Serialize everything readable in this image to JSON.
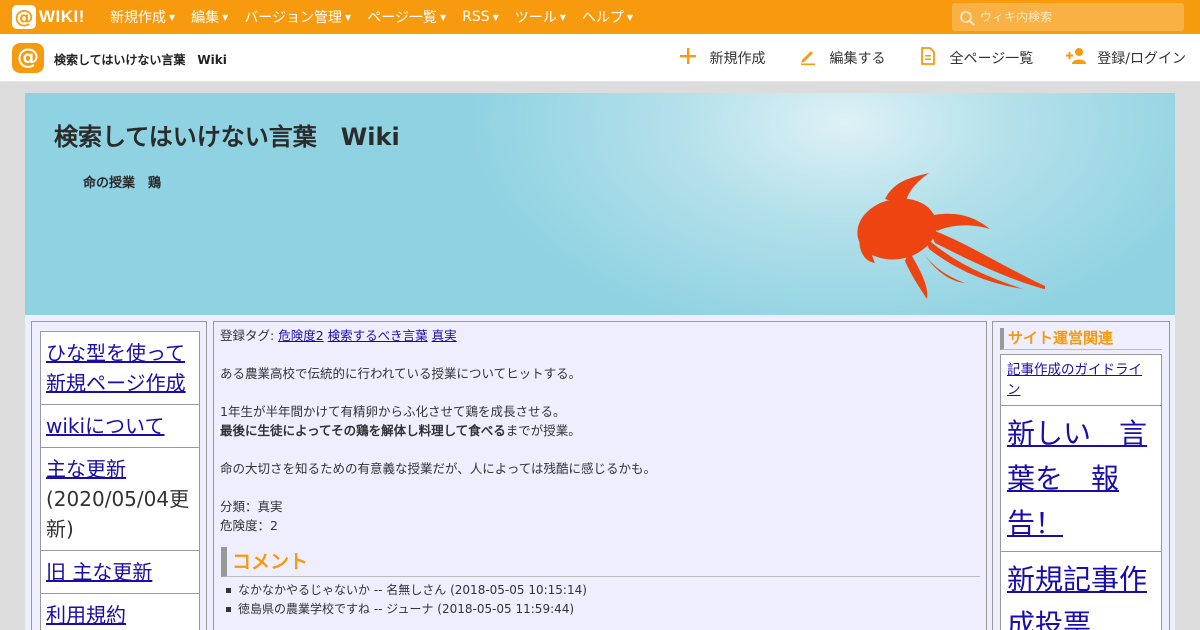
{
  "topbar": {
    "logo_text": "WIKI!",
    "nav": [
      {
        "label": "新規作成"
      },
      {
        "label": "編集"
      },
      {
        "label": "バージョン管理"
      },
      {
        "label": "ページ一覧"
      },
      {
        "label": "RSS"
      },
      {
        "label": "ツール"
      },
      {
        "label": "ヘルプ"
      }
    ],
    "search_placeholder": "ウィキ内検索",
    "accent_color": "#f79a0e"
  },
  "subbar": {
    "site_title": "検索してはいけない言葉　Wiki",
    "actions": [
      {
        "icon": "plus-icon",
        "label": "新規作成"
      },
      {
        "icon": "pencil-icon",
        "label": "編集する"
      },
      {
        "icon": "document-icon",
        "label": "全ページ一覧"
      },
      {
        "icon": "add-user-icon",
        "label": "登録/ログイン"
      }
    ]
  },
  "banner": {
    "title": "検索してはいけない言葉　Wiki",
    "page_name": "命の授業　鶏",
    "image": "goldfish-silhouette"
  },
  "left_menu": {
    "items": [
      {
        "link": "ひな型を使って新規ページ作成",
        "note": ""
      },
      {
        "link": "wikiについて",
        "note": ""
      },
      {
        "link": "主な更新",
        "note": "(2020/05/04更新)"
      },
      {
        "link": "旧 主な更新",
        "note": ""
      },
      {
        "link": "利用規約",
        "note": ""
      }
    ]
  },
  "content": {
    "tags_label": "登録タグ:",
    "tags": [
      "危険度2",
      "検索するべき言葉",
      "真実"
    ],
    "intro": "ある農業高校で伝統的に行われている授業についてヒットする。",
    "detail_1": "1年生が半年間かけて有精卵からふ化させて鶏を成長させる。",
    "detail_bold": "最後に生徒によってその鶏を解体し料理して食べる",
    "detail_tail": "までが授業。",
    "opinion": "命の大切さを知るための有意義な授業だが、人によっては残酷に感じるかも。",
    "category": "分類：真実",
    "danger": "危険度：2",
    "comment_heading": "コメント",
    "comments": [
      {
        "text": "なかなかやるじゃないか -- 名無しさん (2018-05-05 10:15:14)"
      },
      {
        "text": "徳島県の農業学校ですね -- ジューナ (2018-05-05 11:59:44)"
      }
    ]
  },
  "right_menu": {
    "heading": "サイト運営関連",
    "links": [
      {
        "label": "記事作成のガイドライン"
      },
      {
        "label": "新しい　言葉を　報告！"
      },
      {
        "label": "新規記事作成投票"
      }
    ]
  }
}
